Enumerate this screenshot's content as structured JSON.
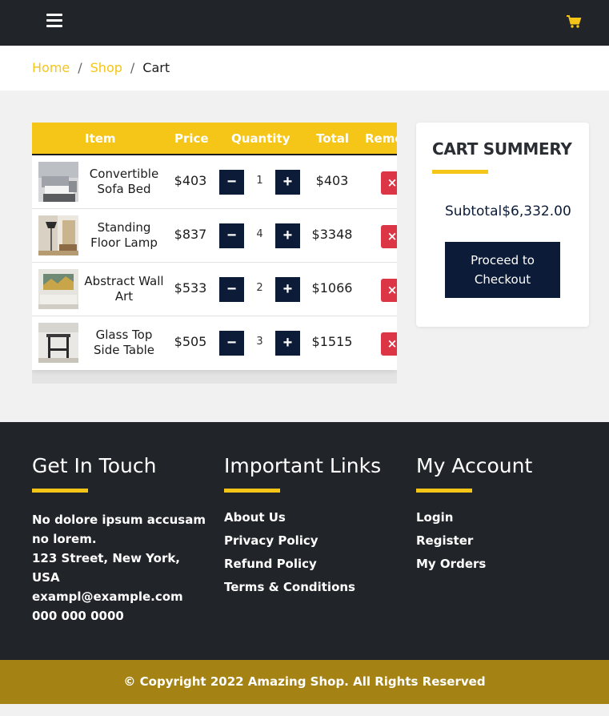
{
  "header": {
    "menu_icon": "hamburger-icon",
    "cart_icon": "shopping-cart-icon",
    "accent_color": "#f5c518"
  },
  "breadcrumb": {
    "home": "Home",
    "shop": "Shop",
    "separator": "/",
    "current": "Cart"
  },
  "cart_table": {
    "columns": [
      "Item",
      "Price",
      "Quantity",
      "Total",
      "Remove"
    ],
    "rows": [
      {
        "name": "Convertible Sofa Bed",
        "price": "$403",
        "quantity": "1",
        "total": "$403",
        "minus": "−",
        "plus": "+",
        "remove": "×"
      },
      {
        "name": "Standing Floor Lamp",
        "price": "$837",
        "quantity": "4",
        "total": "$3348",
        "minus": "−",
        "plus": "+",
        "remove": "×"
      },
      {
        "name": "Abstract Wall Art",
        "price": "$533",
        "quantity": "2",
        "total": "$1066",
        "minus": "−",
        "plus": "+",
        "remove": "×"
      },
      {
        "name": "Glass Top Side Table",
        "price": "$505",
        "quantity": "3",
        "total": "$1515",
        "minus": "−",
        "plus": "+",
        "remove": "×"
      }
    ]
  },
  "summary": {
    "title": "CART SUMMERY",
    "subtotal_label": "Subtotal",
    "subtotal_value": "$6,332.00",
    "checkout_label": "Proceed to Checkout"
  },
  "footer": {
    "touch": {
      "title": "Get In Touch",
      "about": "No dolore ipsum accusam no lorem.",
      "address": "123 Street, New York, USA",
      "email": "exampl@example.com",
      "phone": "000 000 0000"
    },
    "links": {
      "title": "Important Links",
      "items": [
        "About Us",
        "Privacy Policy",
        "Refund Policy",
        "Terms & Conditions"
      ]
    },
    "account": {
      "title": "My Account",
      "items": [
        "Login",
        "Register",
        "My Orders"
      ]
    },
    "copyright": "© Copyright 2022 Amazing Shop. All Rights Reserved"
  }
}
